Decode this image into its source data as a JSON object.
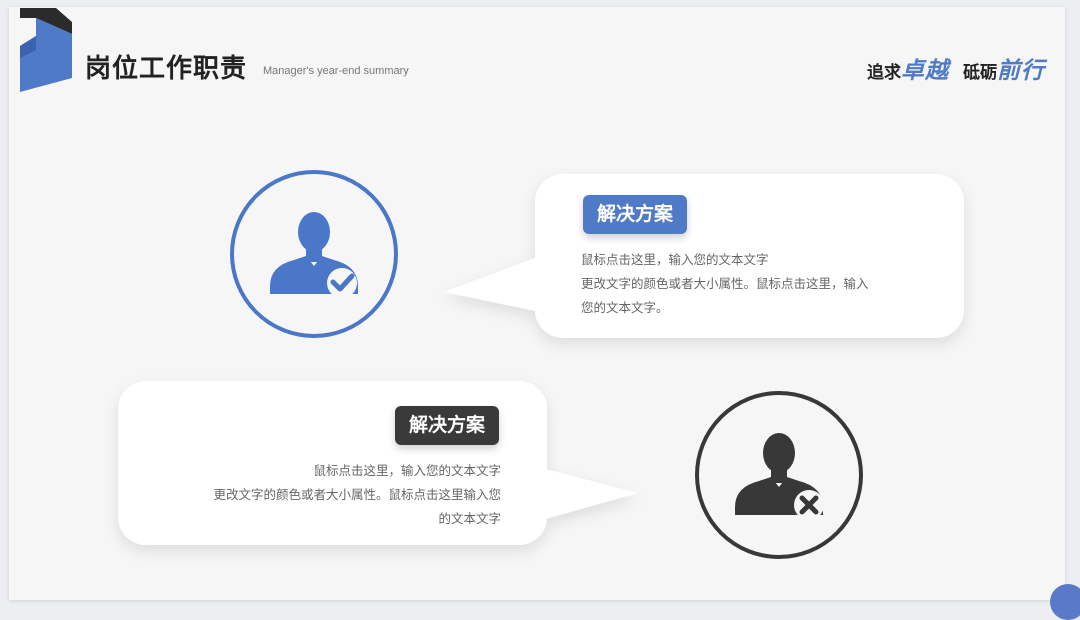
{
  "header": {
    "title": "岗位工作职责",
    "subtitle": "Manager's year-end summary",
    "slogan_part1_prefix": "追求",
    "slogan_part1_emphasis": "卓越",
    "slogan_part2_prefix": "砥砺",
    "slogan_part2_emphasis": "前行"
  },
  "cards": [
    {
      "tag": "解决方案",
      "lines": [
        "鼠标点击这里，输入您的文本文字",
        "更改文字的颜色或者大小属性。鼠标点击这里，输入",
        "您的文本文字。"
      ],
      "icon": "user-check-icon",
      "accent": "#4f7ac7"
    },
    {
      "tag": "解决方案",
      "lines": [
        "鼠标点击这里，输入您的文本文字",
        "更改文字的颜色或者大小属性。鼠标点击这里输入您",
        "的文本文字"
      ],
      "icon": "user-cross-icon",
      "accent": "#3a3a3a"
    }
  ],
  "colors": {
    "blue": "#4a77c8",
    "dark": "#383838",
    "background": "#f6f6f7"
  }
}
